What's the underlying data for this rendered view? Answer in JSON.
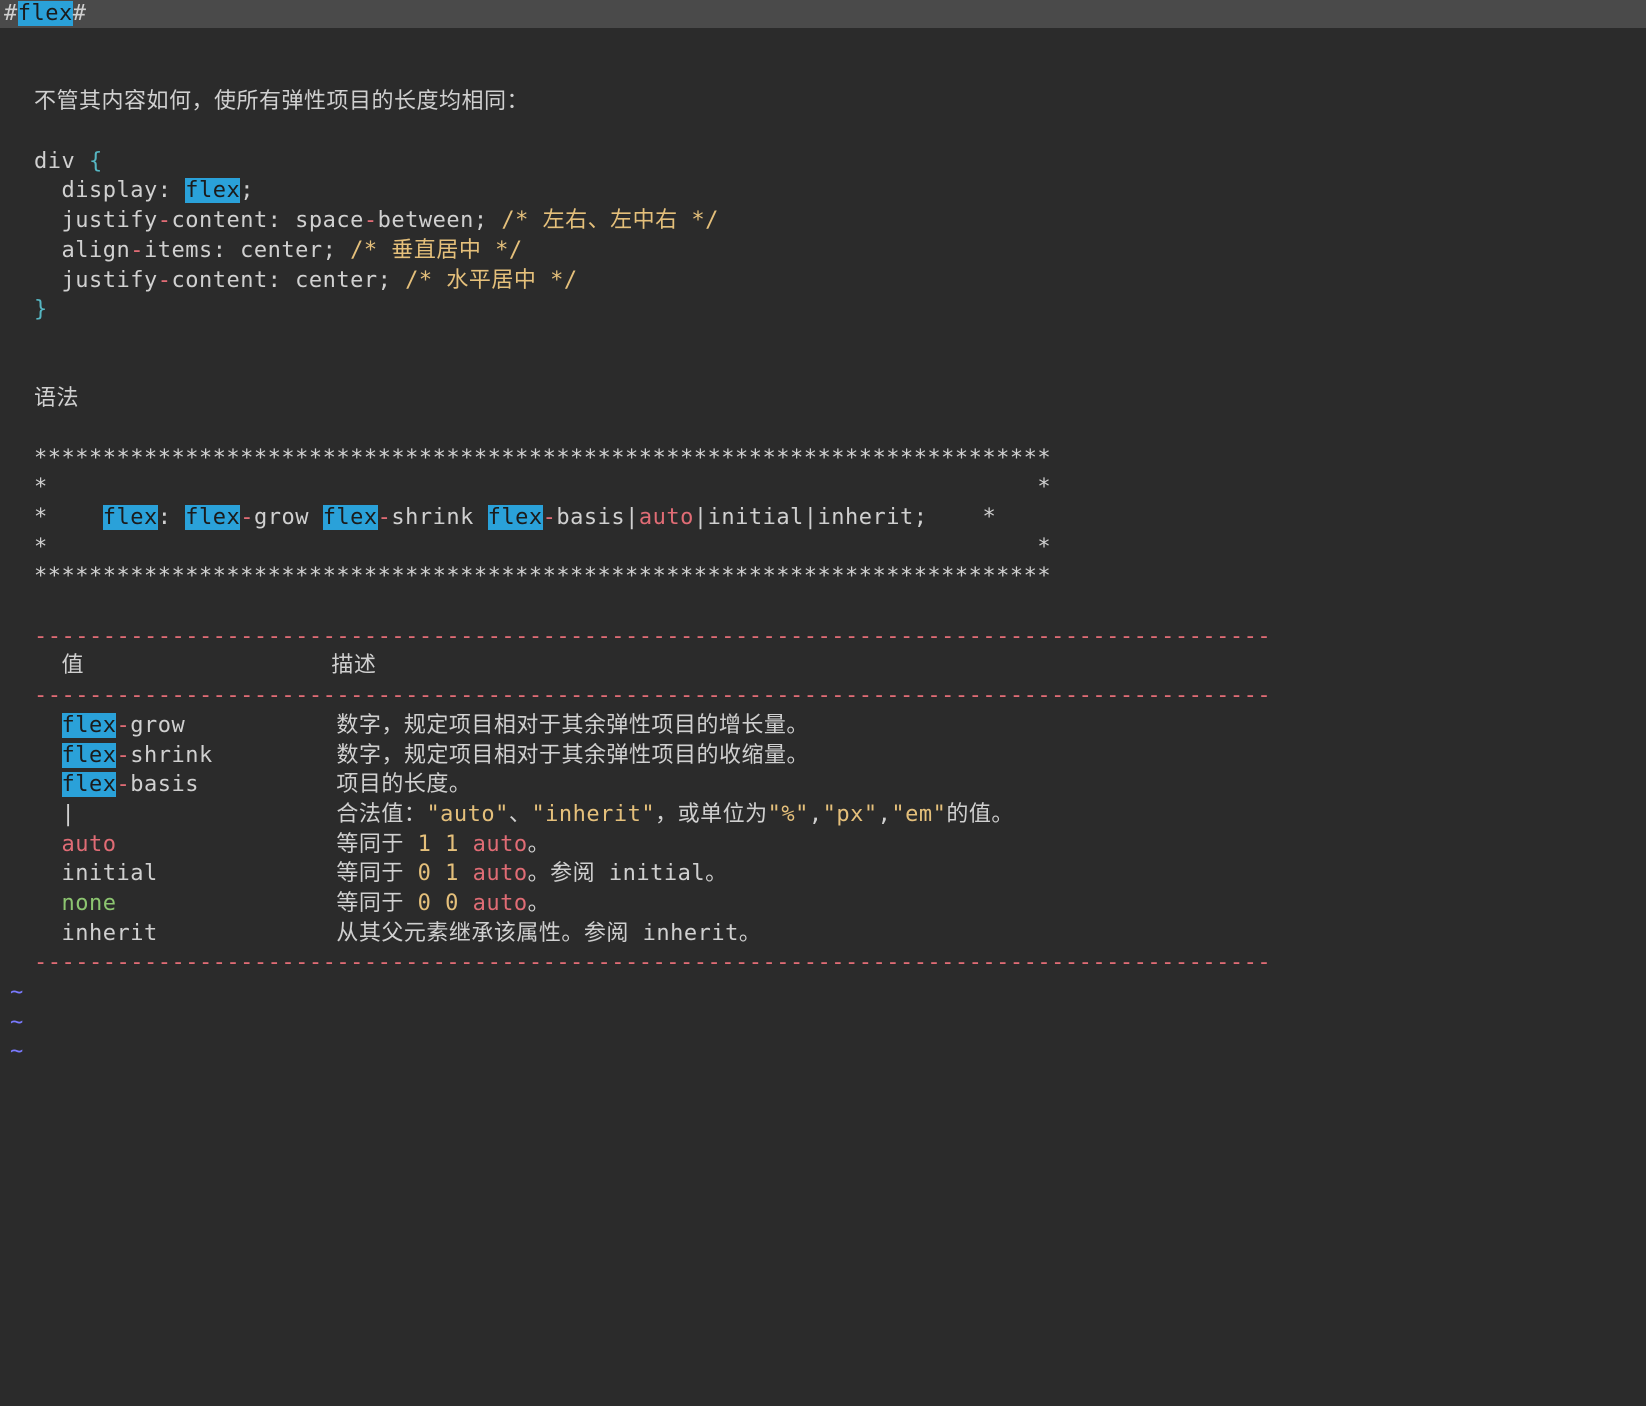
{
  "topbar": {
    "prefix": "#",
    "term": "flex",
    "suffix": "#"
  },
  "line_blank": " ",
  "line_intro": "不管其内容如何，使所有弹性项目的长度均相同：",
  "code": {
    "l1_a": "div ",
    "l1_b": "{",
    "l2_a": "  display: ",
    "l2_b": "flex",
    "l2_c": ";",
    "l3_a": "  justify",
    "l3_b": "-",
    "l3_c": "content: space",
    "l3_d": "-",
    "l3_e": "between; ",
    "l3_f": "/* 左右、左中右 */",
    "l4_a": "  align",
    "l4_b": "-",
    "l4_c": "items: center; ",
    "l4_d": "/* 垂直居中 */",
    "l5_a": "  justify",
    "l5_b": "-",
    "l5_c": "content: center; ",
    "l5_d": "/* 水平居中 */",
    "l6_a": "}"
  },
  "syntax_label": "语法",
  "box": {
    "top": "**************************************************************************",
    "empty": "*                                                                        *",
    "mid_pre": "*    ",
    "mid_flex": "flex",
    "mid_a": ": ",
    "mid_f2": "flex",
    "mid_b": "-",
    "mid_c": "grow ",
    "mid_f3": "flex",
    "mid_d": "-",
    "mid_e": "shrink ",
    "mid_f4": "flex",
    "mid_f": "-",
    "mid_g": "basis|",
    "mid_auto": "auto",
    "mid_h": "|initial|inherit;    *",
    "bot": "**************************************************************************"
  },
  "dash90": "------------------------------------------------------------------------------------------",
  "header": {
    "col1": "  值",
    "col2": "描述"
  },
  "rows": {
    "r1_a": "flex",
    "r1_b": "-",
    "r1_c": "grow",
    "r1_desc": "数字，规定项目相对于其余弹性项目的增长量。",
    "r2_a": "flex",
    "r2_b": "-",
    "r2_c": "shrink",
    "r2_desc": "数字，规定项目相对于其余弹性项目的收缩量。",
    "r3_a": "flex",
    "r3_b": "-",
    "r3_c": "basis",
    "r3_desc": "项目的长度。",
    "r4_val": "|",
    "r4_d1": "合法值：",
    "r4_q1": "\"auto\"",
    "r4_d2": "、",
    "r4_q2": "\"inherit\"",
    "r4_d3": "，或单位为",
    "r4_q3": "\"%\"",
    "r4_d4": ",",
    "r4_q4": "\"px\"",
    "r4_d5": ",",
    "r4_q5": "\"em\"",
    "r4_d6": "的值。",
    "r5_val": "auto",
    "r5_d1": "等同于 ",
    "r5_n": "1 1 ",
    "r5_auto": "auto",
    "r5_d2": "。",
    "r6_val": "initial",
    "r6_d1": "等同于 ",
    "r6_n": "0 1 ",
    "r6_auto": "auto",
    "r6_d2": "。参阅 initial。",
    "r7_val": "none",
    "r7_d1": "等同于 ",
    "r7_n": "0 0 ",
    "r7_auto": "auto",
    "r7_d2": "。",
    "r8_val": "inherit",
    "r8_desc": "从其父元素继承该属性。参阅 inherit。"
  },
  "tilde": "~"
}
